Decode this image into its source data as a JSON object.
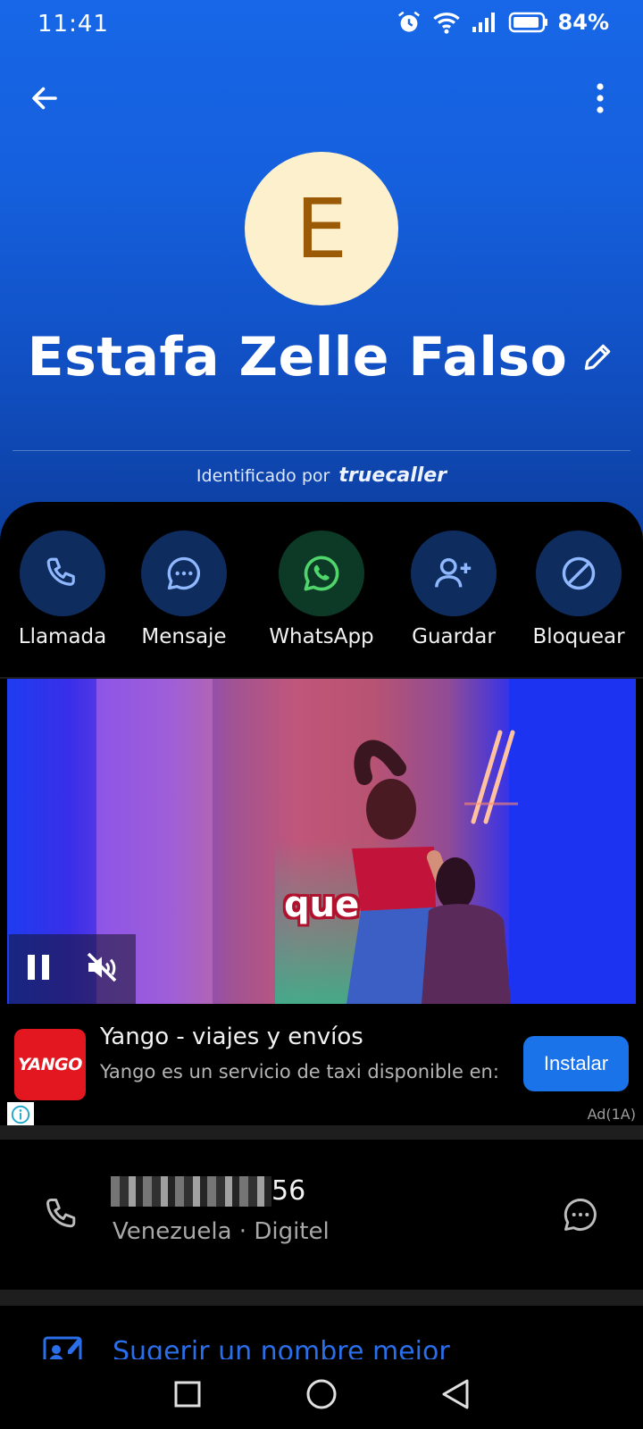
{
  "status_bar": {
    "time": "11:41",
    "battery_percent": "84%",
    "icons": [
      "alarm-icon",
      "wifi-icon",
      "signal-icon",
      "battery-icon"
    ]
  },
  "header": {
    "back_icon": "arrow-left-icon",
    "menu_icon": "more-vertical-icon"
  },
  "contact": {
    "avatar_letter": "E",
    "name": "Estafa Zelle Falso",
    "identified_by_prefix": "Identificado por",
    "identified_by_brand": "truecaller"
  },
  "actions": [
    {
      "label": "Llamada",
      "icon": "phone-icon"
    },
    {
      "label": "Mensaje",
      "icon": "chat-icon"
    },
    {
      "label": "WhatsApp",
      "icon": "whatsapp-icon"
    },
    {
      "label": "Guardar",
      "icon": "add-contact-icon"
    },
    {
      "label": "Bloquear",
      "icon": "block-icon"
    }
  ],
  "ad": {
    "video_caption": "que",
    "logo_text": "YANGO",
    "title": "Yango - viajes y envíos",
    "description": "Yango es un servicio de taxi disponible en:",
    "install_label": "Instalar",
    "ad_label": "Ad(1A)"
  },
  "number": {
    "visible_suffix": "56",
    "country": "Venezuela",
    "separator": "·",
    "carrier": "Digitel"
  },
  "suggest": {
    "label": "Sugerir un nombre mejor"
  },
  "colors": {
    "hero_blue": "#1767e8",
    "action_circle": "#0f2c5e",
    "whatsapp_circle": "#0d3a26",
    "link_blue": "#2a6ee9",
    "install_blue": "#1a73e8",
    "yango_red": "#e2171f"
  }
}
